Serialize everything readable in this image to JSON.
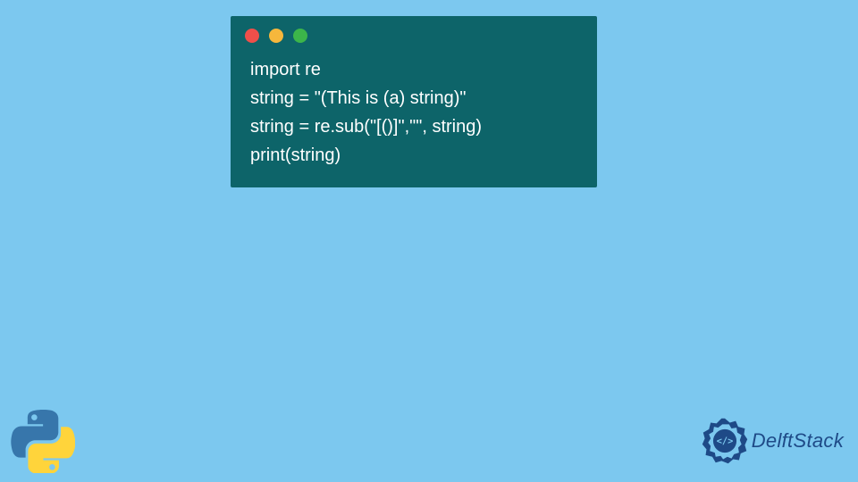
{
  "window": {
    "dots": {
      "red": "#ee4f4a",
      "yellow": "#f6b73c",
      "green": "#3cb54a"
    }
  },
  "code": {
    "lines": [
      "import re",
      "string = \"(This is (a) string)\"",
      "string = re.sub(\"[()]\",\"\", string)",
      "print(string)"
    ]
  },
  "branding": {
    "python_icon": "python-logo",
    "delft_icon": "delftstack-emblem",
    "delft_text": "DelftStack"
  }
}
